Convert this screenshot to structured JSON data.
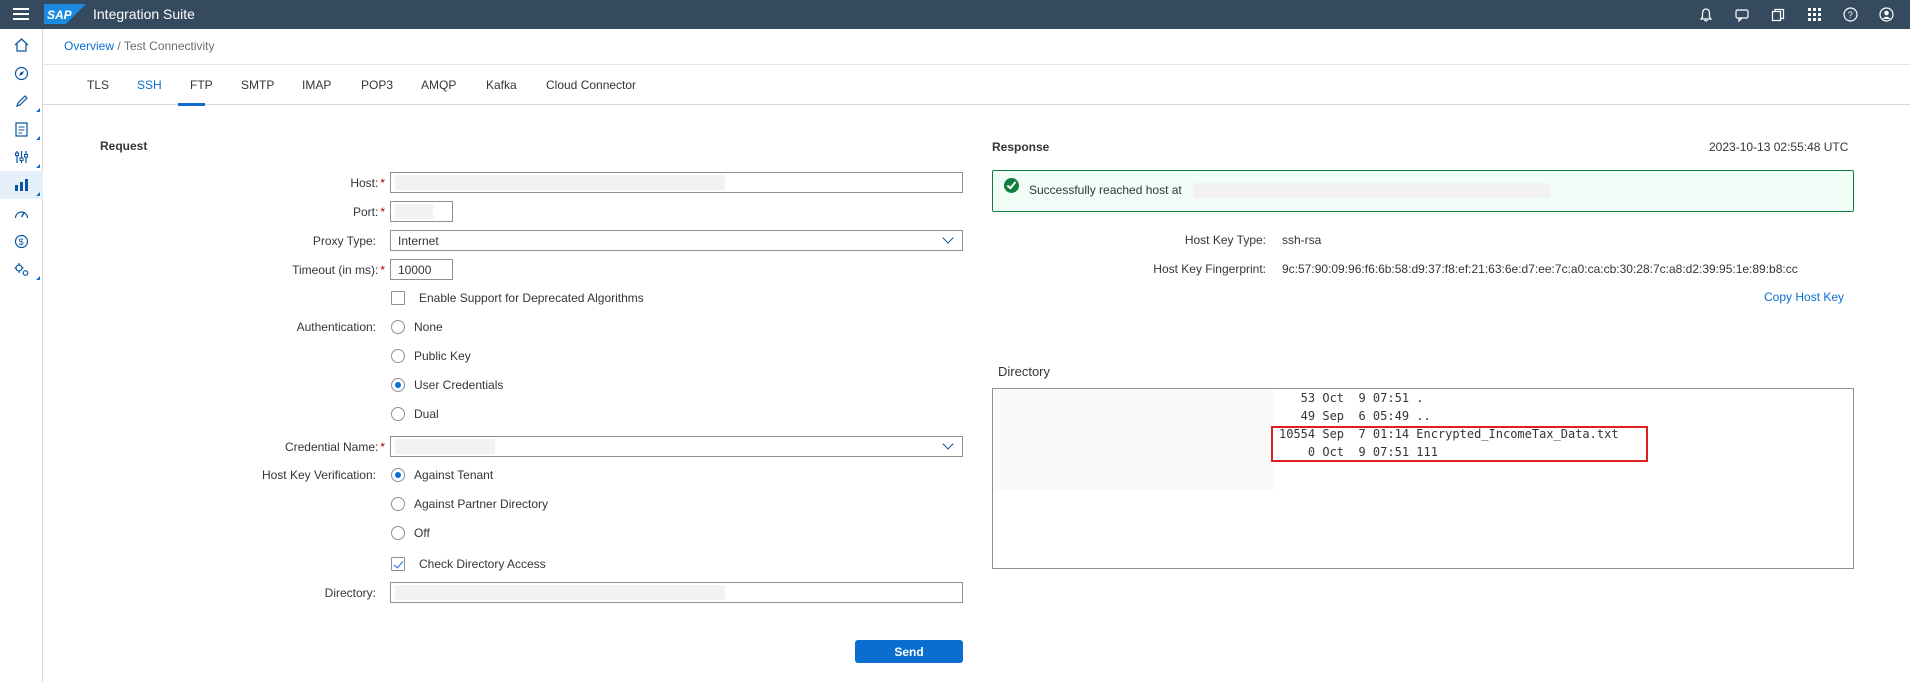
{
  "shell": {
    "brand": "SAP",
    "app_title": "Integration Suite",
    "icons": [
      "bell-icon",
      "feedback-icon",
      "copy-icon",
      "grid-icon",
      "help-icon",
      "user-icon"
    ]
  },
  "sidenav": {
    "items": [
      "home-icon",
      "discover-icon",
      "design-icon",
      "monitor-icon",
      "settings-icon",
      "analytics-icon",
      "speed-icon",
      "billing-icon",
      "config-icon"
    ]
  },
  "breadcrumb": {
    "link": "Overview",
    "separator": " / ",
    "current": "Test Connectivity"
  },
  "tabs": [
    "TLS",
    "SSH",
    "FTP",
    "SMTP",
    "IMAP",
    "POP3",
    "AMQP",
    "Kafka",
    "Cloud Connector"
  ],
  "active_tab": "SSH",
  "request": {
    "title": "Request",
    "host_label": "Host:",
    "port_label": "Port:",
    "proxy_label": "Proxy Type:",
    "proxy_value": "Internet",
    "timeout_label": "Timeout (in ms):",
    "timeout_value": "10000",
    "deprecated_label": "Enable Support for Deprecated Algorithms",
    "auth_label": "Authentication:",
    "auth_options": [
      "None",
      "Public Key",
      "User Credentials",
      "Dual"
    ],
    "auth_selected": "User Credentials",
    "credential_label": "Credential Name:",
    "hostkey_label": "Host Key Verification:",
    "hostkey_options": [
      "Against Tenant",
      "Against Partner Directory",
      "Off"
    ],
    "hostkey_selected": "Against Tenant",
    "check_dir_label": "Check Directory Access",
    "directory_label": "Directory:",
    "send_label": "Send"
  },
  "response": {
    "title": "Response",
    "timestamp": "2023-10-13 02:55:48 UTC",
    "success_message": "Successfully reached host at",
    "host_key_type_label": "Host Key Type:",
    "host_key_type": "ssh-rsa",
    "fingerprint_label": "Host Key Fingerprint:",
    "fingerprint": "9c:57:90:09:96:f6:6b:58:d9:37:f8:ef:21:63:6e:d7:ee:7c:a0:ca:cb:30:28:7c:a8:d2:39:95:1e:89:b8:cc",
    "copy_label": "Copy Host Key",
    "directory_label": "Directory",
    "listing": [
      "   53 Oct  9 07:51 .",
      "   49 Sep  6 05:49 ..",
      "10554 Sep  7 01:14 Encrypted_IncomeTax_Data.txt",
      "    0 Oct  9 07:51 111"
    ]
  },
  "colors": {
    "shell_bg": "#354a5f",
    "accent": "#0a6ed1",
    "success": "#107e3e",
    "highlight": "#e02020"
  }
}
